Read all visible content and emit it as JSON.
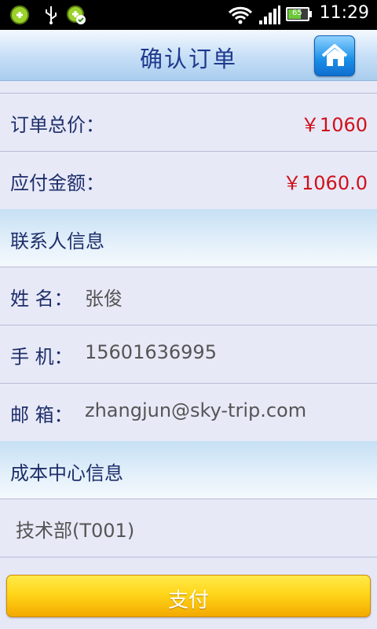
{
  "status_bar": {
    "time": "11:29",
    "battery_level": "65",
    "icons": [
      "app-plus-icon",
      "usb-icon",
      "app-check-icon",
      "wifi-icon",
      "signal-icon",
      "battery-icon"
    ]
  },
  "header": {
    "title": "确认订单",
    "home_icon": "home-icon"
  },
  "order": {
    "total_label": "订单总价：",
    "total_value": "￥1060",
    "payable_label": "应付金额：",
    "payable_value": "￥1060.0"
  },
  "contact": {
    "section_title": "联系人信息",
    "name_label": "姓 名：",
    "name_value": "张俊",
    "phone_label": "手 机：",
    "phone_value": "15601636995",
    "email_label": "邮 箱：",
    "email_value": "zhangjun@sky-trip.com"
  },
  "cost_center": {
    "section_title": "成本中心信息",
    "value": "技术部(T001)"
  },
  "actions": {
    "pay_label": "支付"
  },
  "colors": {
    "price": "#d1101a",
    "label": "#1e2e6a",
    "title": "#1e3a8e",
    "pay_button": "#ffd619"
  }
}
